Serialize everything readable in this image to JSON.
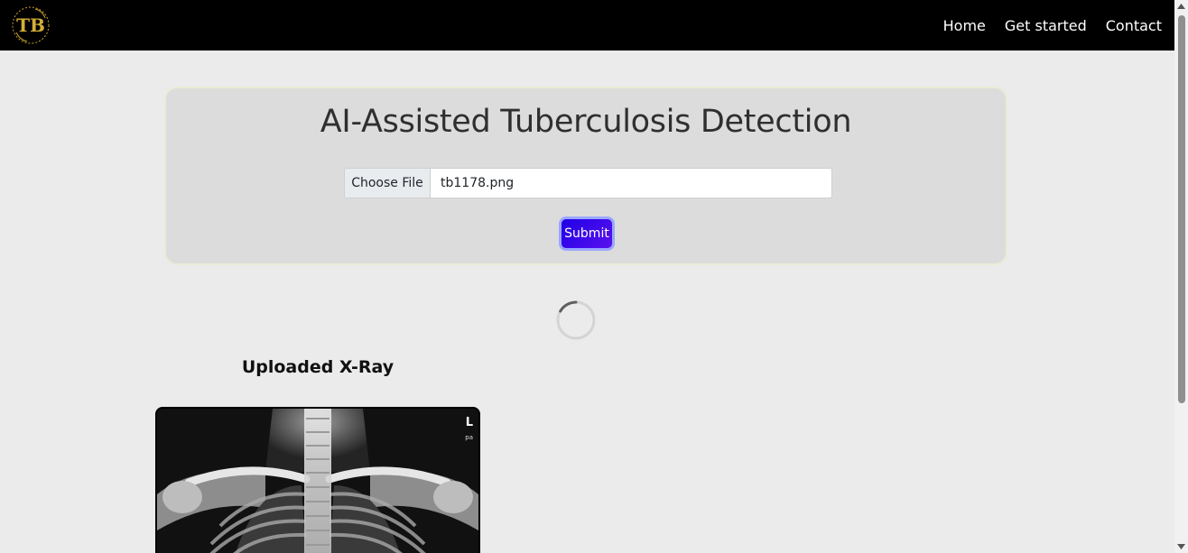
{
  "nav": {
    "logo_text": "TB",
    "links": [
      "Home",
      "Get started",
      "Contact"
    ]
  },
  "form": {
    "title": "AI-Assisted Tuberculosis Detection",
    "choose_file_label": "Choose File",
    "file_name": "tb1178.png",
    "submit_label": "Submit"
  },
  "result": {
    "heading": "Uploaded X-Ray",
    "xray_marker": "L",
    "xray_sub_marker": "pa"
  },
  "colors": {
    "navbar": "#000000",
    "page_bg": "#ebebeb",
    "card_bg": "#dcdcdc",
    "submit_accent": "#2a05e8",
    "logo_gold": "#c9a227"
  }
}
